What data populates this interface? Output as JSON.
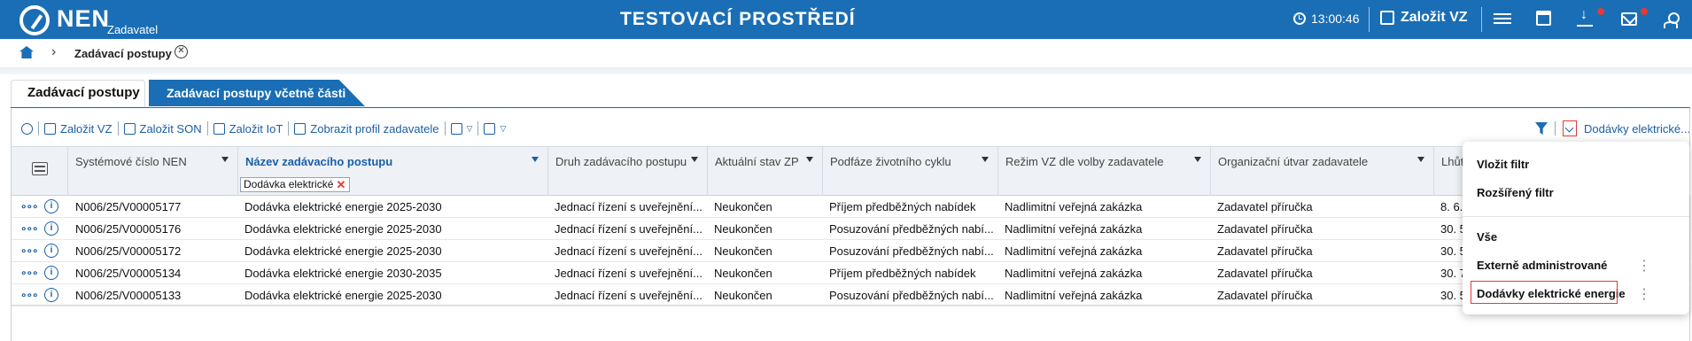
{
  "header": {
    "logo_text": "NEN",
    "logo_sub": "Zadavatel",
    "env_title": "TESTOVACÍ PROSTŘEDÍ",
    "time": "13:00:46",
    "create_vz": "Založit VZ"
  },
  "breadcrumb": {
    "current": "Zadávací postupy"
  },
  "tabs": [
    {
      "label": "Zadávací postupy",
      "active": true
    },
    {
      "label": "Zadávací postupy včetně části",
      "active": false
    }
  ],
  "toolbar": {
    "zalozit_vz": "Založit VZ",
    "zalozit_son": "Založit SON",
    "zalozit_iot": "Založit IoT",
    "zobrazit_profil": "Zobrazit profil zadavatele",
    "active_filter": "Dodávky elektrické..."
  },
  "table": {
    "columns": [
      "Systémové číslo NEN",
      "Název zadávacího postupu",
      "Druh zadávacího postupu",
      "Aktuální stav ZP",
      "Podfáze životního cyklu",
      "Režim VZ dle volby zadavatele",
      "Organizační útvar zadavatele",
      "Lhůt"
    ],
    "name_filter": "Dodávka elektrické",
    "rows": [
      [
        "N006/25/V00005177",
        "Dodávka elektrické energie 2025-2030",
        "Jednací řízení s uveřejnění...",
        "Neukončen",
        "Příjem předběžných nabídek",
        "Nadlimitní veřejná zakázka",
        "Zadavatel příručka",
        "8. 6."
      ],
      [
        "N006/25/V00005176",
        "Dodávka elektrické energie 2025-2030",
        "Jednací řízení s uveřejnění...",
        "Neukončen",
        "Posuzování předběžných nabí...",
        "Nadlimitní veřejná zakázka",
        "Zadavatel příručka",
        "30. 5"
      ],
      [
        "N006/25/V00005172",
        "Dodávka elektrické energie 2025-2030",
        "Jednací řízení s uveřejnění...",
        "Neukončen",
        "Posuzování předběžných nabí...",
        "Nadlimitní veřejná zakázka",
        "Zadavatel příručka",
        "30. 5"
      ],
      [
        "N006/25/V00005134",
        "Dodávka elektrické energie 2030-2035",
        "Jednací řízení s uveřejnění...",
        "Neukončen",
        "Příjem předběžných nabídek",
        "Nadlimitní veřejná zakázka",
        "Zadavatel příručka",
        "30. 7"
      ],
      [
        "N006/25/V00005133",
        "Dodávka elektrické energie 2025-2030",
        "Jednací řízení s uveřejnění...",
        "Neukončen",
        "Posuzování předběžných nabí...",
        "Nadlimitní veřejná zakázka",
        "Zadavatel příručka",
        "30. 5"
      ]
    ]
  },
  "dropdown": {
    "items": [
      "Vložit filtr",
      "Rozšířený filtr",
      "Vše",
      "Externě administrované",
      "Dodávky elektrické energie"
    ]
  },
  "icons": {
    "clock": "clock-icon",
    "pencil": "pencil-icon",
    "menu": "hamburger-icon",
    "calendar": "calendar-icon",
    "download": "download-icon",
    "mail": "mail-icon",
    "user": "user-icon",
    "home": "home-icon",
    "filter": "funnel-icon"
  },
  "colors": {
    "brand": "#1a6eb5",
    "alert": "#e53935"
  }
}
